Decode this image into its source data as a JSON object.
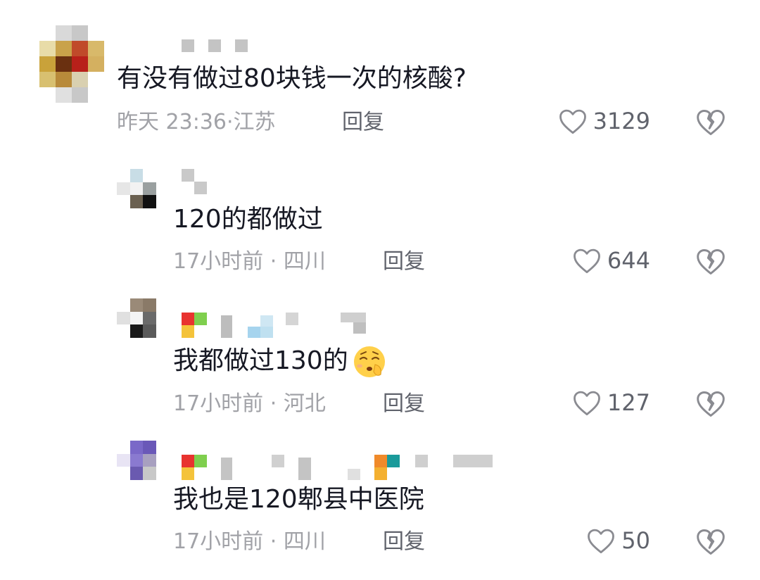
{
  "comments": [
    {
      "text": "有没有做过80块钱一次的核酸?",
      "time": "昨天 23:36",
      "location": "江苏",
      "reply_label": "回复",
      "likes": "3129"
    },
    {
      "text": "120的都做过",
      "time": "17小时前",
      "location": "四川",
      "reply_label": "回复",
      "likes": "644"
    },
    {
      "text": "我都做过130的",
      "emoji": "worried-shushing-face-emoji",
      "time": "17小时前",
      "location": "河北",
      "reply_label": "回复",
      "likes": "127"
    },
    {
      "text": "我也是120郫县中医院",
      "time": "17小时前",
      "location": "四川",
      "reply_label": "回复",
      "likes": "50"
    }
  ],
  "meta_separator": "·",
  "icons": {
    "like": "heart-outline-icon",
    "dislike": "broken-heart-icon"
  },
  "colors": {
    "text": "#161823",
    "meta": "#a1a2a7",
    "action": "#60636c",
    "icon": "#8a8b91"
  }
}
